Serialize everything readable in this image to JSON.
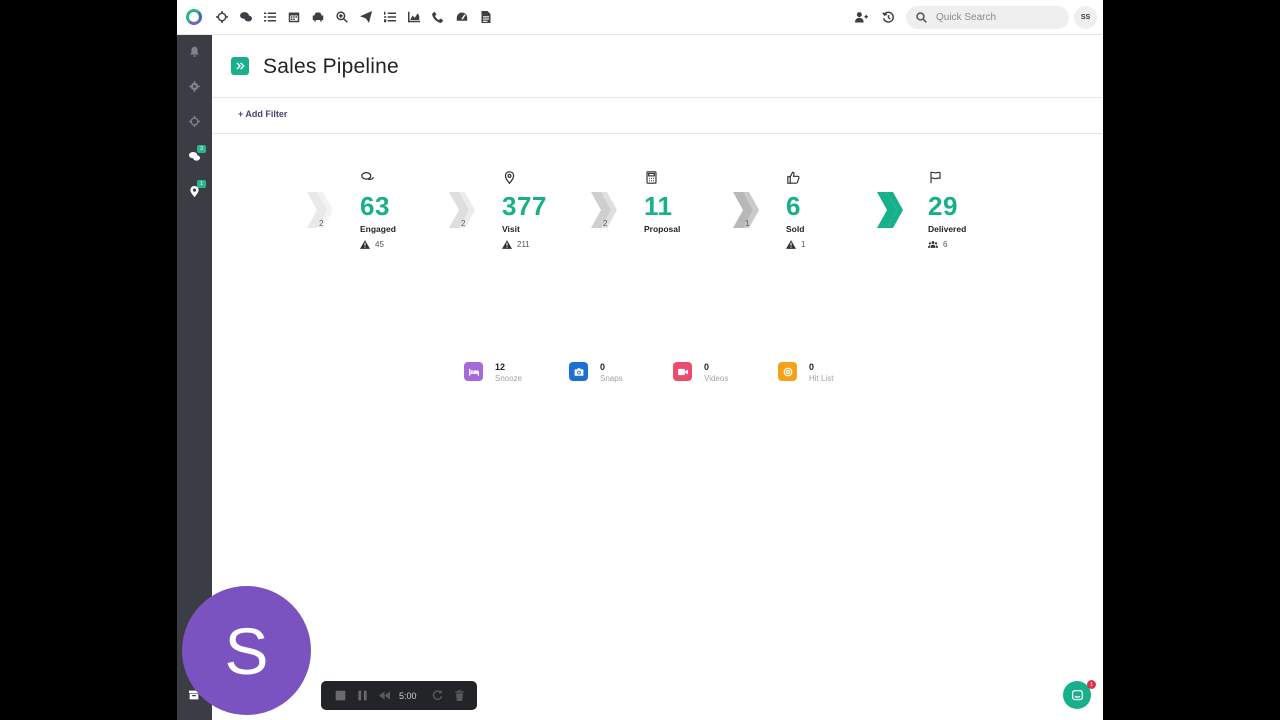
{
  "toolbar": {
    "icons": [
      "crosshair-icon",
      "chat-icon",
      "list-icon",
      "calendar-icon",
      "car-icon",
      "search-plus-icon",
      "send-icon",
      "ordered-list-icon",
      "area-chart-icon",
      "phone-icon",
      "dashboard-icon",
      "document-icon"
    ],
    "search_placeholder": "Quick Search",
    "user_initials": "SS"
  },
  "sidebar": {
    "items": [
      {
        "name": "bell-icon",
        "badge": ""
      },
      {
        "name": "gear-icon",
        "badge": ""
      },
      {
        "name": "crosshair-icon",
        "badge": ""
      },
      {
        "name": "chat-icon",
        "badge": "3"
      },
      {
        "name": "map-pin-icon",
        "badge": "1"
      }
    ]
  },
  "page": {
    "title": "Sales Pipeline",
    "add_filter": "+ Add Filter"
  },
  "pipeline": {
    "stages": [
      {
        "label": "Engaged",
        "count": "63",
        "chevron_count": "2",
        "warn": "45",
        "icon": "chat-icon"
      },
      {
        "label": "Visit",
        "count": "377",
        "chevron_count": "2",
        "warn": "211",
        "icon": "map-pin-icon"
      },
      {
        "label": "Proposal",
        "count": "11",
        "chevron_count": "2",
        "warn": "",
        "icon": "calculator-icon"
      },
      {
        "label": "Sold",
        "count": "6",
        "chevron_count": "1",
        "warn": "1",
        "icon": "thumbs-up-icon"
      },
      {
        "label": "Delivered",
        "count": "29",
        "chevron_count": "",
        "people": "6",
        "icon": "flag-icon"
      }
    ]
  },
  "mini_stats": [
    {
      "label": "Snooze",
      "value": "12",
      "color": "#a36ad8",
      "icon": "bed-icon"
    },
    {
      "label": "Snaps",
      "value": "0",
      "color": "#1f6fd1",
      "icon": "camera-icon"
    },
    {
      "label": "Videos",
      "value": "0",
      "color": "#ec4b6e",
      "icon": "video-icon"
    },
    {
      "label": "Hit List",
      "value": "0",
      "color": "#f4a11b",
      "icon": "target-icon"
    }
  ],
  "overlays": {
    "avatar_letter": "S",
    "recorder_time": "5:00",
    "chat_badge": "1"
  },
  "colors": {
    "accent": "#17b08a",
    "sidebar_bg": "#3a3d43"
  }
}
